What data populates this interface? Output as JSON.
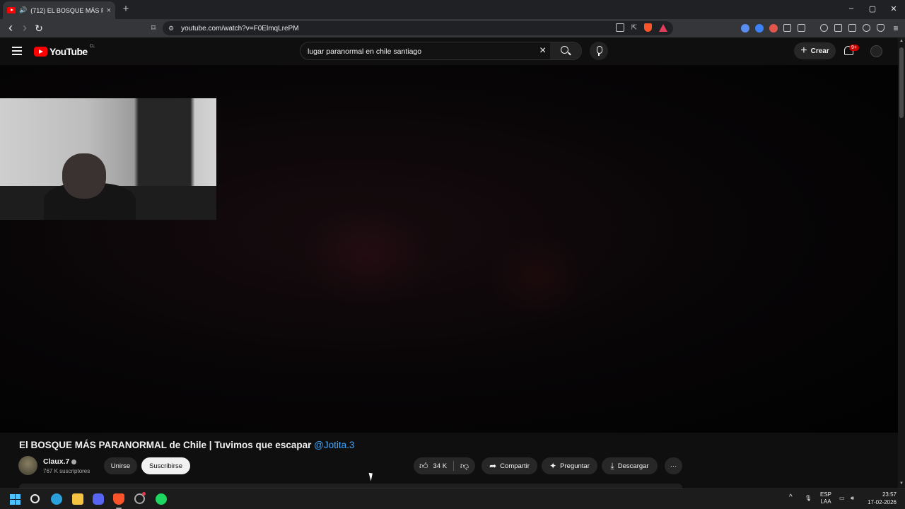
{
  "browser": {
    "tab_title": "(712) EL BOSQUE MÁS PARAN",
    "tab_close": "×",
    "new_tab": "+",
    "url": "youtube.com/watch?v=F0ElmqLrePM",
    "window_controls": {
      "minimize": "–",
      "maximize": "▢",
      "close": "✕"
    },
    "nav": {
      "back": "‹",
      "forward": "›",
      "reload": "↻"
    }
  },
  "youtube": {
    "logo_text": "YouTube",
    "country_code": "CL",
    "search_query": "lugar paranormal en chile santiago",
    "clear_label": "×",
    "create_label": "Crear",
    "create_plus": "+",
    "notifications_badge": "9+"
  },
  "video": {
    "title": "El BOSQUE MÁS PARANORMAL de Chile | Tuvimos que escapar",
    "mention": "@Jotita.3",
    "channel_name": "Claux.7",
    "subscribers": "767 K suscriptores",
    "join_label": "Unirse",
    "subscribe_label": "Suscribirse",
    "likes": "34 K",
    "share_label": "Compartir",
    "ask_label": "Preguntar",
    "download_label": "Descargar",
    "more_label": "···"
  },
  "taskbar": {
    "lang_top": "ESP",
    "lang_bottom": "LAA",
    "time": "23:57",
    "date": "17-02-2026",
    "tray_chevron": "^"
  },
  "colors": {
    "youtube_red": "#ff0000",
    "mention_blue": "#3ea6ff",
    "background": "#0f0f0f"
  }
}
